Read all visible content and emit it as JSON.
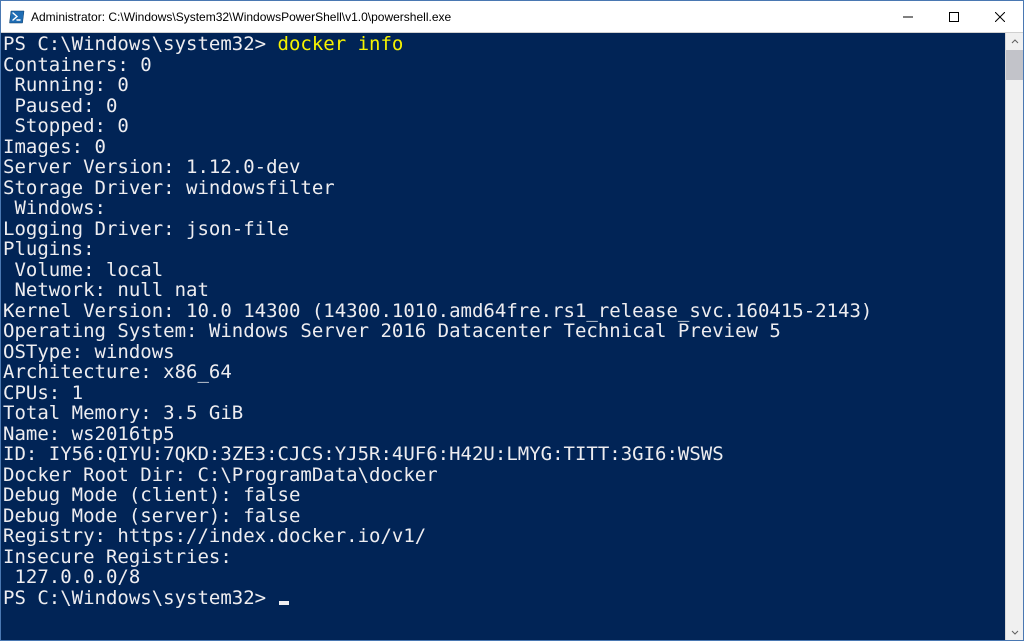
{
  "window": {
    "title": "Administrator: C:\\Windows\\System32\\WindowsPowerShell\\v1.0\\powershell.exe"
  },
  "prompt1": "PS C:\\Windows\\system32> ",
  "command": "docker info",
  "output_lines": [
    "Containers: 0",
    " Running: 0",
    " Paused: 0",
    " Stopped: 0",
    "Images: 0",
    "Server Version: 1.12.0-dev",
    "Storage Driver: windowsfilter",
    " Windows:",
    "Logging Driver: json-file",
    "Plugins:",
    " Volume: local",
    " Network: null nat",
    "Kernel Version: 10.0 14300 (14300.1010.amd64fre.rs1_release_svc.160415-2143)",
    "Operating System: Windows Server 2016 Datacenter Technical Preview 5",
    "OSType: windows",
    "Architecture: x86_64",
    "CPUs: 1",
    "Total Memory: 3.5 GiB",
    "Name: ws2016tp5",
    "ID: IY56:QIYU:7QKD:3ZE3:CJCS:YJ5R:4UF6:H42U:LMYG:TITT:3GI6:WSWS",
    "Docker Root Dir: C:\\ProgramData\\docker",
    "Debug Mode (client): false",
    "Debug Mode (server): false",
    "Registry: https://index.docker.io/v1/",
    "Insecure Registries:",
    " 127.0.0.0/8"
  ],
  "prompt2": "PS C:\\Windows\\system32> "
}
